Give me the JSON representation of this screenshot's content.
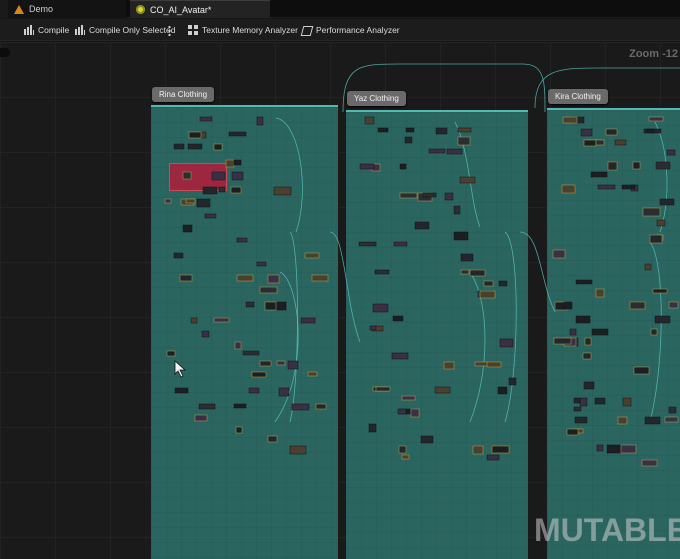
{
  "tabs": [
    {
      "label": "Demo"
    },
    {
      "label": "CO_AI_Avatar*"
    }
  ],
  "toolbar": {
    "compile": "Compile",
    "compile_only_selected": "Compile Only Selected",
    "texture_memory": "Texture Memory Analyzer",
    "performance": "Performance Analyzer"
  },
  "graph": {
    "zoom": "Zoom -12",
    "comments": [
      {
        "title": "Rina Clothing"
      },
      {
        "title": "Yaz Clothing"
      },
      {
        "title": "Kira Clothing"
      }
    ],
    "watermark": "MUTABLE"
  },
  "colors": {
    "comment_fill": "#2d6b66",
    "comment_border": "#58c7bd",
    "error_node": "#a82843",
    "background": "#1a1a1a"
  }
}
